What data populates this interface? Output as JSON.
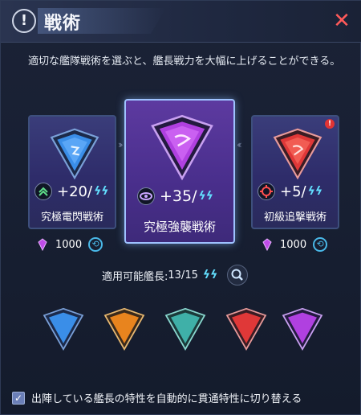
{
  "header": {
    "title": "戦術",
    "info_glyph": "!",
    "close_glyph": "✕"
  },
  "description": "適切な艦隊戦術を選ぶと、艦長戦力を大幅に上げることができる。",
  "tactics": [
    {
      "name": "究極電閃戦術",
      "stat": "+20/",
      "stat_icon": "chevrons-up-icon",
      "emblem_color": "#3a8ee8",
      "cost": "1000"
    },
    {
      "name": "究極強襲戦術",
      "stat": "+35/",
      "stat_icon": "eye-swirl-icon",
      "emblem_color": "#b040e0"
    },
    {
      "name": "初級追撃戦術",
      "stat": "+5/",
      "stat_icon": "crosshair-icon",
      "emblem_color": "#e03838",
      "cost": "1000",
      "alert": "!"
    }
  ],
  "applicable": {
    "label": "適用可能艦長:",
    "value": "13/15"
  },
  "mini_emblems": [
    {
      "name": "lightning",
      "color": "#3a8ee8"
    },
    {
      "name": "fire",
      "color": "#e8841e"
    },
    {
      "name": "vortex",
      "color": "#3fb0a8"
    },
    {
      "name": "pursuit",
      "color": "#e03838"
    },
    {
      "name": "assault",
      "color": "#b040e0"
    }
  ],
  "auto_switch": {
    "checked": true,
    "label": "出陣している艦長の特性を自動的に貫通特性に切り替える"
  },
  "colors": {
    "accent": "#63e0ff",
    "close": "#ff5a5a",
    "selected_border": "#9ec2ff"
  }
}
